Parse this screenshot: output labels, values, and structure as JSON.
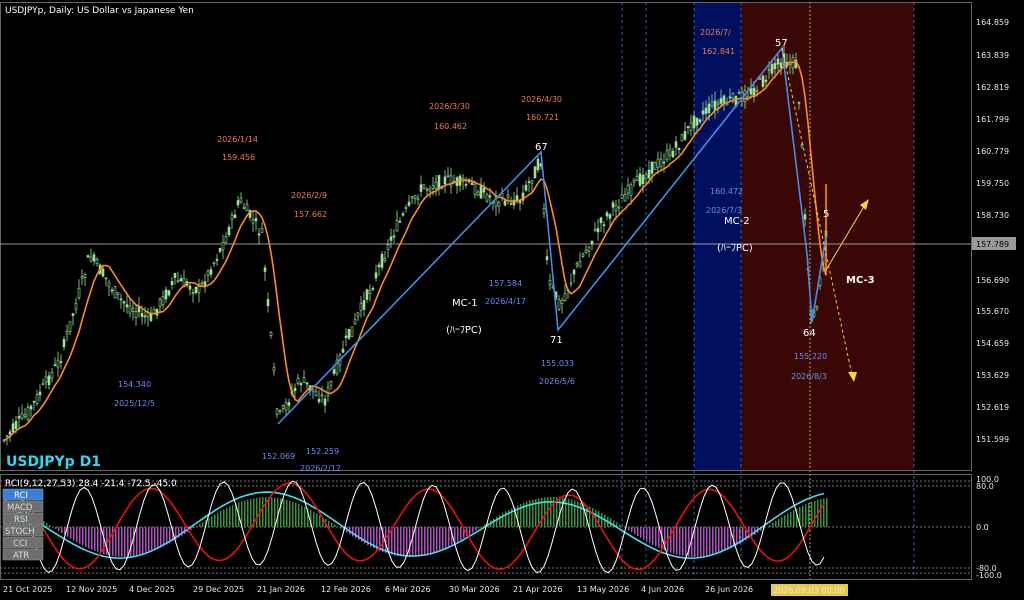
{
  "window": {
    "title": "USDJPYp, Daily:  US Dollar vs Japanese Yen",
    "symbol_label": "USDJPYp D1",
    "current_price": "157.789",
    "cursor_time": "2026.09.03 00:00"
  },
  "indicator": {
    "header": "RCI(9,12,27,53) 28.4 -21.4 -72.5 -45.0",
    "tabs": [
      "RCI",
      "MACD",
      "RSI",
      "STOCH",
      "CCI",
      "ATR"
    ],
    "active_tab": "RCI",
    "right_ticks": [
      "100.0",
      "80.0",
      "0.0",
      "-80.0",
      "-100.0"
    ]
  },
  "price_axis": [
    "164.859",
    "163.839",
    "162.819",
    "161.799",
    "160.779",
    "159.750",
    "158.730",
    "157.789",
    "156.690",
    "155.670",
    "154.659",
    "153.629",
    "152.619",
    "151.599"
  ],
  "date_axis": [
    "21 Oct 2025",
    "12 Nov 2025",
    "4 Dec 2025",
    "29 Dec 2025",
    "21 Jan 2026",
    "12 Feb 2026",
    "6 Mar 2026",
    "30 Mar 2026",
    "21 Apr 2026",
    "13 May 2026",
    "4 Jun 2026",
    "26 Jun 2026"
  ],
  "annotations": [
    {
      "id": "ann-1",
      "text": "2026/1/14",
      "kind": "high"
    },
    {
      "id": "ann-2",
      "text": "159.456",
      "kind": "high"
    },
    {
      "id": "ann-3",
      "text": "2026/2/9",
      "kind": "high"
    },
    {
      "id": "ann-4",
      "text": "157.662",
      "kind": "high"
    },
    {
      "id": "ann-5",
      "text": "2026/3/30",
      "kind": "high"
    },
    {
      "id": "ann-6",
      "text": "160.462",
      "kind": "high"
    },
    {
      "id": "ann-7",
      "text": "2026/4/30",
      "kind": "high"
    },
    {
      "id": "ann-8",
      "text": "160.721",
      "kind": "high"
    },
    {
      "id": "ann-9",
      "text": "2026/7/",
      "kind": "high"
    },
    {
      "id": "ann-10",
      "text": "162.841",
      "kind": "high"
    },
    {
      "id": "ann-11",
      "text": "154.340",
      "kind": "low"
    },
    {
      "id": "ann-12",
      "text": "2025/12/5",
      "kind": "low"
    },
    {
      "id": "ann-13",
      "text": "152.069",
      "kind": "low"
    },
    {
      "id": "ann-14",
      "text": "152.259",
      "kind": "low"
    },
    {
      "id": "ann-15",
      "text": "2026/2/12",
      "kind": "low"
    },
    {
      "id": "ann-16",
      "text": "157.584",
      "kind": "low"
    },
    {
      "id": "ann-17",
      "text": "2026/4/17",
      "kind": "low"
    },
    {
      "id": "ann-18",
      "text": "155.033",
      "kind": "low"
    },
    {
      "id": "ann-19",
      "text": "2026/5/6",
      "kind": "low"
    },
    {
      "id": "ann-20",
      "text": "160.472",
      "kind": "low"
    },
    {
      "id": "ann-21",
      "text": "2026/7/3",
      "kind": "low"
    },
    {
      "id": "ann-22",
      "text": "155.220",
      "kind": "low"
    },
    {
      "id": "ann-23",
      "text": "2026/8/3",
      "kind": "low"
    }
  ],
  "waves": [
    "67",
    "71",
    "57",
    "64",
    "5"
  ],
  "mc_labels": [
    "MC-1",
    "(ﾊｰﾌPC)",
    "MC-2",
    "(ﾊｰﾌPC)",
    "MC-3"
  ],
  "colors": {
    "background": "#000000",
    "candle": "#98e398",
    "ma": "#ff8c1a",
    "zigzag": "#3f8fe8",
    "high_annotation": "#f07850",
    "low_annotation": "#6d8cf0",
    "shade_blue": "#00105e",
    "shade_red": "#3a0707",
    "rci_short": "#ffffff",
    "rci_mid": "#e81010",
    "rci_long": "#40e0e8",
    "label_cyan": "#2fd8f0",
    "projection_yellow": "#ffd23c"
  }
}
